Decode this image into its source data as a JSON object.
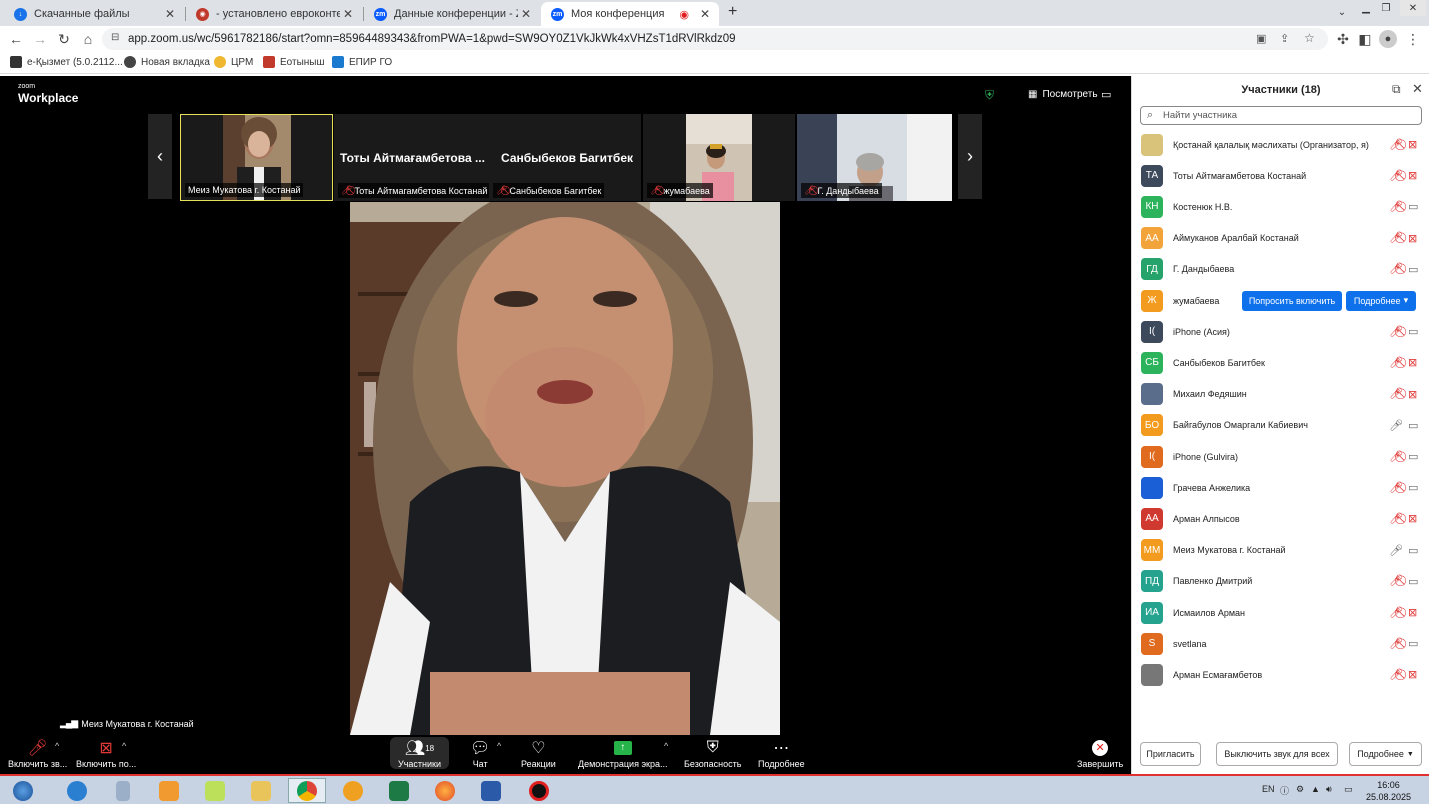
{
  "browser": {
    "tabs": [
      {
        "label": "Скачанные файлы",
        "icon": "download-icon",
        "active": false
      },
      {
        "label": "- установлено евроконтейнеров",
        "icon": "site-icon",
        "active": false
      },
      {
        "label": "Данные конференции - Zoom",
        "icon": "zoom-icon",
        "active": false
      },
      {
        "label": "Моя конференция",
        "icon": "zoom-icon",
        "active": true
      }
    ],
    "new_tab": "+",
    "url": "app.zoom.us/wc/5961782186/start?omn=85964489343&fromPWA=1&pwd=SW9OY0Z1VkJkWk4xVHZsT1dRVlRkdz09",
    "bookmarks": [
      "e-Қызмет (5.0.2112...",
      "Новая вкладка",
      "ЦРМ",
      "Еотыныш",
      "ЕПИР ГО"
    ]
  },
  "zoom": {
    "logo_small": "zoom",
    "logo_large": "Workplace",
    "view_button": "Посмотреть",
    "thumbnails": [
      {
        "name": "Меиз Мукатова г. Костанай",
        "muted": false,
        "video": true,
        "big_name": ""
      },
      {
        "name": "Тоты Айтмагамбетова Костанай",
        "muted": true,
        "video": false,
        "big_name": "Тоты Айтмағамбетова ..."
      },
      {
        "name": "Санбыбеков Багитбек",
        "muted": true,
        "video": false,
        "big_name": "Санбыбеков Багитбек"
      },
      {
        "name": "жумабаева",
        "muted": true,
        "video": true,
        "big_name": ""
      },
      {
        "name": "Г. Дандыбаева",
        "muted": true,
        "video": true,
        "big_name": ""
      }
    ],
    "active_speaker": "Меиз Мукатова г. Костанай",
    "toolbar": {
      "unmute": "Включить зв...",
      "start_video": "Включить по...",
      "participants": "Участники",
      "participants_count": "18",
      "chat": "Чат",
      "reactions": "Реакции",
      "share": "Демонстрация экра...",
      "security": "Безопасность",
      "more": "Подробнее",
      "end": "Завершить"
    }
  },
  "panel": {
    "title": "Участники (18)",
    "search_placeholder": "Найти участника",
    "participants": [
      {
        "name": "Қостанай қалалық мәслихаты (Организатор, я)",
        "initials": "",
        "color": "#d9c27a",
        "mic": "muted",
        "cam": "off"
      },
      {
        "name": "Тоты Айтмағамбетова Костанай",
        "initials": "ТА",
        "color": "#3d4a5c",
        "mic": "muted",
        "cam": "off"
      },
      {
        "name": "Костенюк Н.В.",
        "initials": "КН",
        "color": "#2db35c",
        "mic": "muted",
        "cam": "on"
      },
      {
        "name": "Аймуканов Аралбай Костанай",
        "initials": "АА",
        "color": "#f2a33a",
        "mic": "muted",
        "cam": "off"
      },
      {
        "name": "Г. Дандыбаева",
        "initials": "ГД",
        "color": "#25a36b",
        "mic": "muted",
        "cam": "on"
      },
      {
        "name": "жумабаева",
        "initials": "Ж",
        "color": "#f29b1e",
        "mic": "",
        "cam": ""
      },
      {
        "name": "iPhone (Асия)",
        "initials": "I(",
        "color": "#3d4a5c",
        "mic": "muted",
        "cam": "on"
      },
      {
        "name": "Санбыбеков Багитбек",
        "initials": "СБ",
        "color": "#2db35c",
        "mic": "muted",
        "cam": "off"
      },
      {
        "name": "Михаил Федяшин",
        "initials": "",
        "color": "#5a6e8c",
        "mic": "muted",
        "cam": "off"
      },
      {
        "name": "Байгабулов Омаргали Кабиевич",
        "initials": "БО",
        "color": "#f29b1e",
        "mic": "on",
        "cam": "on"
      },
      {
        "name": "iPhone (Gulvira)",
        "initials": "I(",
        "color": "#e06a1e",
        "mic": "muted",
        "cam": "on"
      },
      {
        "name": "Грачева Анжелика",
        "initials": "",
        "color": "#1a5fd6",
        "mic": "muted",
        "cam": "on"
      },
      {
        "name": "Арман Алпысов",
        "initials": "АА",
        "color": "#d0392f",
        "mic": "muted",
        "cam": "off"
      },
      {
        "name": "Меиз Мукатова г. Костанай",
        "initials": "ММ",
        "color": "#f29b1e",
        "mic": "on",
        "cam": "on"
      },
      {
        "name": "Павленко Дмитрий",
        "initials": "ПД",
        "color": "#25a38f",
        "mic": "muted",
        "cam": "on"
      },
      {
        "name": "Исмаилов Арман",
        "initials": "ИА",
        "color": "#25a38f",
        "mic": "muted",
        "cam": "off"
      },
      {
        "name": "svetlana",
        "initials": "S",
        "color": "#e06a1e",
        "mic": "muted",
        "cam": "on"
      },
      {
        "name": "Арман Есмағамбетов",
        "initials": "",
        "color": "#777",
        "mic": "muted",
        "cam": "off"
      }
    ],
    "ask_unmute": "Попросить включить",
    "more_row": "Подробнее",
    "invite": "Пригласить",
    "mute_all": "Выключить звук для всех",
    "more_footer": "Подробнее"
  },
  "taskbar": {
    "lang": "EN",
    "time": "16:06",
    "date": "25.08.2025"
  }
}
